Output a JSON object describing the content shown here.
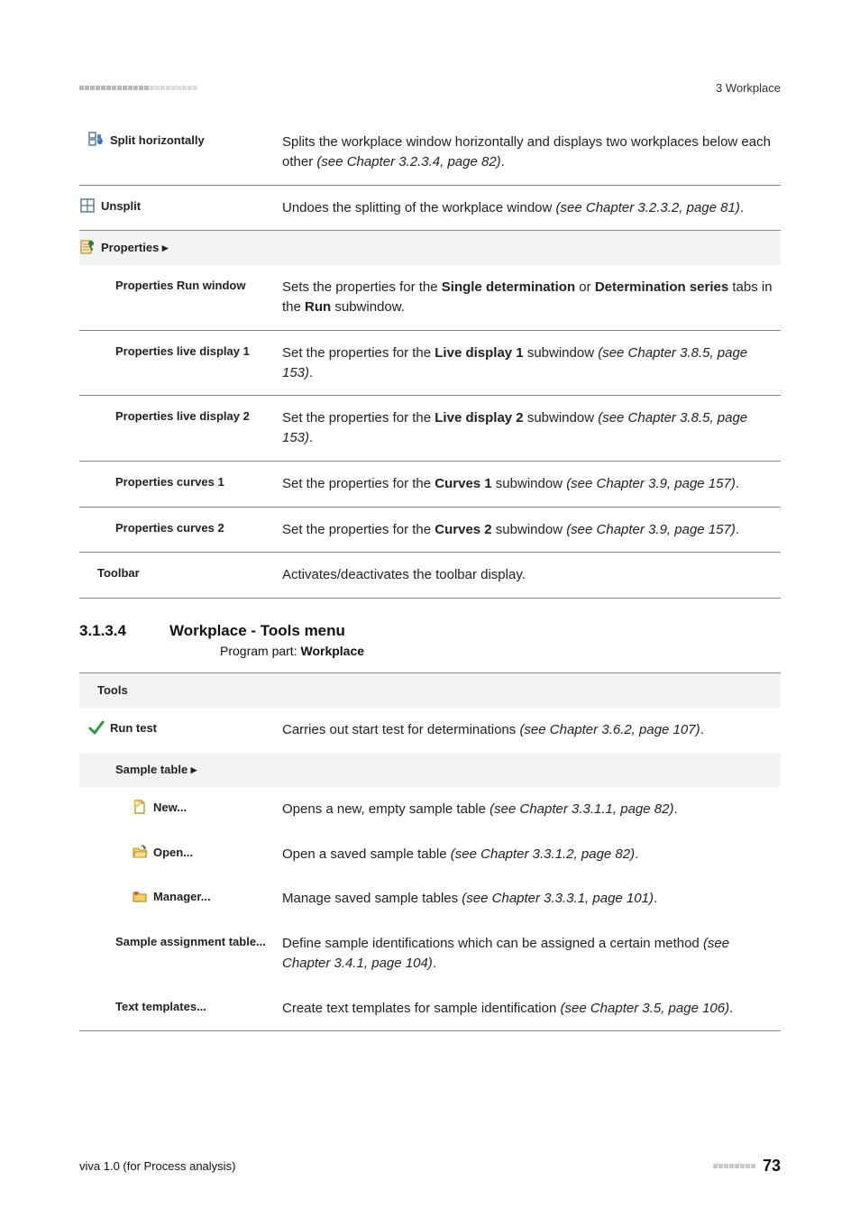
{
  "header": {
    "right": "3 Workplace"
  },
  "rows1": {
    "splitH": {
      "label": "Split horizontally",
      "desc_pre": "Splits the workplace window horizontally and displays two workplaces below each other ",
      "desc_em": "(see Chapter 3.2.3.4, page 82)",
      "desc_post": "."
    },
    "unsplit": {
      "label": "Unsplit",
      "desc_pre": "Undoes the splitting of the workplace window ",
      "desc_em": "(see Chapter 3.2.3.2, page 81)",
      "desc_post": "."
    },
    "propsHeader": {
      "label": "Properties ▸"
    },
    "propsRun": {
      "label": "Properties Run window",
      "desc_p1": "Sets the properties for the ",
      "desc_b1": "Single determination",
      "desc_p2": " or ",
      "desc_b2": "Determination series",
      "desc_p3": " tabs in the ",
      "desc_b3": "Run",
      "desc_p4": " subwindow."
    },
    "live1": {
      "label": "Properties live display 1",
      "desc_p1": "Set the properties for the ",
      "desc_b1": "Live display 1",
      "desc_p2": " subwindow ",
      "desc_em": "(see Chapter 3.8.5, page 153)",
      "desc_post": "."
    },
    "live2": {
      "label": "Properties live display 2",
      "desc_p1": "Set the properties for the ",
      "desc_b1": "Live display 2",
      "desc_p2": " subwindow ",
      "desc_em": "(see Chapter 3.8.5, page 153)",
      "desc_post": "."
    },
    "curves1": {
      "label": "Properties curves 1",
      "desc_p1": "Set the properties for the ",
      "desc_b1": "Curves 1",
      "desc_p2": " subwindow ",
      "desc_em": "(see Chapter 3.9, page 157)",
      "desc_post": "."
    },
    "curves2": {
      "label": "Properties curves 2",
      "desc_p1": "Set the properties for the ",
      "desc_b1": "Curves 2",
      "desc_p2": " subwindow ",
      "desc_em": "(see Chapter 3.9, page 157)",
      "desc_post": "."
    },
    "toolbar": {
      "label": "Toolbar",
      "desc": "Activates/deactivates the toolbar display."
    }
  },
  "section": {
    "num": "3.1.3.4",
    "title": "Workplace - Tools menu",
    "programPartLabel": "Program part: ",
    "programPartValue": "Workplace"
  },
  "rows2": {
    "toolsHeader": {
      "label": "Tools"
    },
    "runTest": {
      "label": "Run test",
      "desc_pre": "Carries out start test for determinations ",
      "desc_em": "(see Chapter 3.6.2, page 107)",
      "desc_post": "."
    },
    "sampleTable": {
      "label": "Sample table ▸"
    },
    "new": {
      "label": "New...",
      "desc_pre": "Opens a new, empty sample table ",
      "desc_em": "(see Chapter 3.3.1.1, page 82)",
      "desc_post": "."
    },
    "open": {
      "label": "Open...",
      "desc_pre": "Open a saved sample table ",
      "desc_em": "(see Chapter 3.3.1.2, page 82)",
      "desc_post": "."
    },
    "manager": {
      "label": "Manager...",
      "desc_pre": "Manage saved sample tables ",
      "desc_em": "(see Chapter 3.3.3.1, page 101)",
      "desc_post": "."
    },
    "sampleAssign": {
      "label": "Sample assignment table...",
      "desc_pre": "Define sample identifications which can be assigned a certain method ",
      "desc_em": "(see Chapter 3.4.1, page 104)",
      "desc_post": "."
    },
    "textTemplates": {
      "label": "Text templates...",
      "desc_pre": "Create text templates for sample identification ",
      "desc_em": "(see Chapter 3.5, page 106)",
      "desc_post": "."
    }
  },
  "footer": {
    "left": "viva 1.0 (for Process analysis)",
    "pageNum": "73"
  }
}
